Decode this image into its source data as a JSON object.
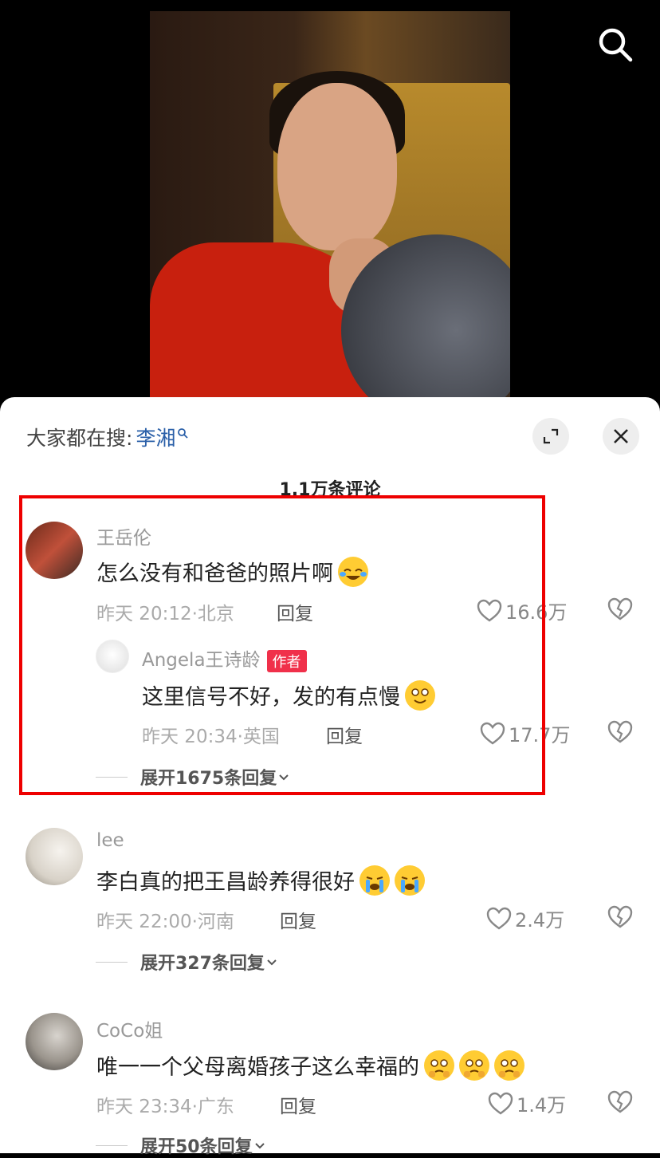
{
  "sheet": {
    "hot_search_label": "大家都在搜:",
    "hot_search_keyword": "李湘",
    "comment_count": "1.1万条评论"
  },
  "comments": [
    {
      "user": "王岳伦",
      "text": "怎么没有和爸爸的照片啊",
      "time": "昨天 20:12",
      "location": "北京",
      "reply_label": "回复",
      "likes": "16.6万",
      "replies": [
        {
          "user": "Angela王诗龄",
          "badge": "作者",
          "text": "这里信号不好，发的有点慢",
          "time": "昨天 20:34",
          "location": "英国",
          "reply_label": "回复",
          "likes": "17.7万"
        }
      ],
      "expand_label": "展开1675条回复"
    },
    {
      "user": "lee",
      "text": "李白真的把王昌龄养得很好",
      "time": "昨天 22:00",
      "location": "河南",
      "reply_label": "回复",
      "likes": "2.4万",
      "expand_label": "展开327条回复"
    },
    {
      "user": "CoCo姐",
      "text": "唯一一个父母离婚孩子这么幸福的",
      "time": "昨天 23:34",
      "location": "广东",
      "reply_label": "回复",
      "likes": "1.4万",
      "expand_label": "展开50条回复"
    }
  ],
  "colors": {
    "highlight_border": "#e00000",
    "author_badge": "#f0304a",
    "keyword_link": "#2a5fa8"
  },
  "icons": [
    "search-icon",
    "expand-icon",
    "close-icon",
    "heart-icon",
    "broken-heart-icon",
    "chevron-down-icon"
  ]
}
